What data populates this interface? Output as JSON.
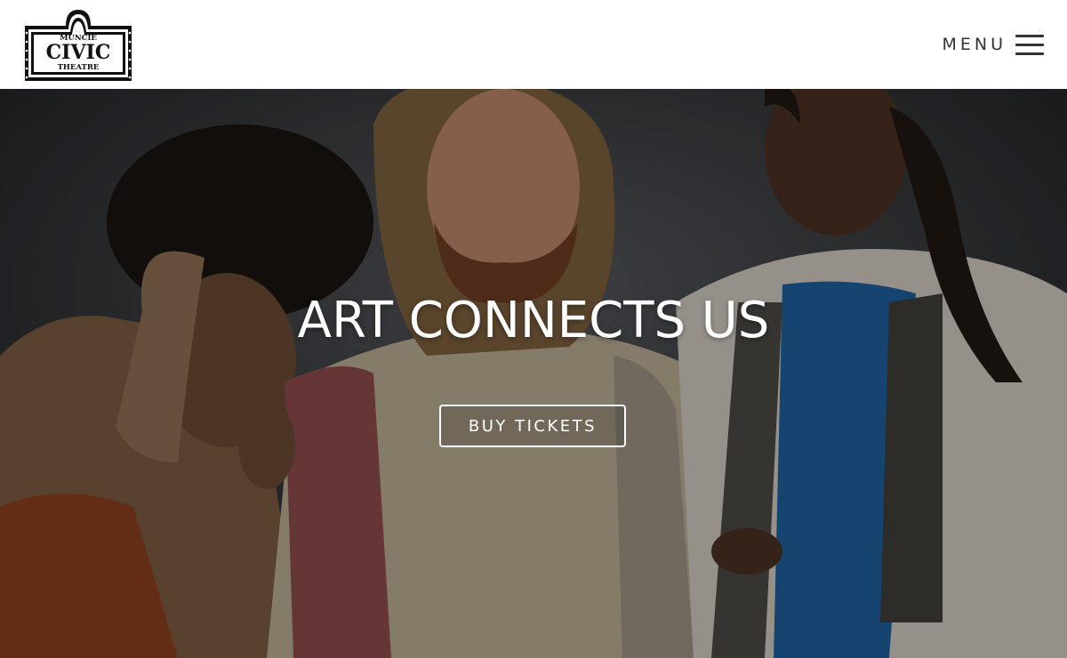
{
  "logo": {
    "line1": "MUNCIE",
    "line2": "CIVIC",
    "line3": "THEATRE"
  },
  "nav": {
    "menu_label": "MENU",
    "menu_icon": "hamburger-menu-icon"
  },
  "hero": {
    "headline": "ART CONNECTS US",
    "cta_label": "BUY TICKETS"
  },
  "colors": {
    "header_bg": "#ffffff",
    "text_dark": "#333333",
    "hero_text": "#ffffff"
  }
}
